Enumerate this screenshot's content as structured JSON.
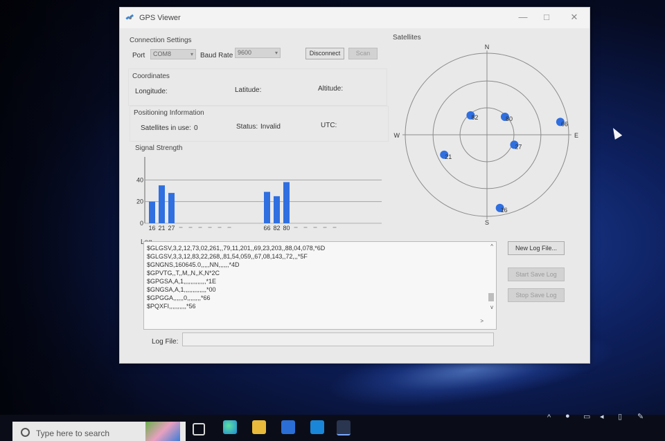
{
  "window": {
    "title": "GPS Viewer",
    "controls": {
      "minimize": "—",
      "maximize": "□",
      "close": "✕"
    }
  },
  "connection": {
    "heading": "Connection Settings",
    "port_label": "Port",
    "port_value": "COM8",
    "baud_label": "Baud Rate",
    "baud_value": "9600",
    "disconnect_label": "Disconnect",
    "scan_label": "Scan"
  },
  "coordinates": {
    "heading": "Coordinates",
    "longitude_label": "Longitude:",
    "latitude_label": "Latitude:",
    "altitude_label": "Altitude:"
  },
  "positioning": {
    "heading": "Positioning Information",
    "sats_label": "Satellites in use:",
    "sats_value": "0",
    "status_label": "Status:",
    "status_value": "Invalid",
    "utc_label": "UTC:"
  },
  "signal": {
    "heading": "Signal Strength"
  },
  "chart_data": {
    "type": "bar",
    "title": "Signal Strength",
    "y_ticks": [
      "0",
      "20",
      "40"
    ],
    "ylim": [
      0,
      60
    ],
    "bar_color": "#2f6fe0",
    "bars": [
      {
        "label": "16",
        "value": 20
      },
      {
        "label": "21",
        "value": 35
      },
      {
        "label": "27",
        "value": 28
      },
      {
        "label": "",
        "value": 0
      },
      {
        "label": "",
        "value": 0
      },
      {
        "label": "",
        "value": 0
      },
      {
        "label": "",
        "value": 0
      },
      {
        "label": "",
        "value": 0
      },
      {
        "label": "",
        "value": 0
      },
      {
        "label": "66",
        "value": 29
      },
      {
        "label": "82",
        "value": 25
      },
      {
        "label": "80",
        "value": 38
      },
      {
        "label": "",
        "value": 0
      },
      {
        "label": "",
        "value": 0
      },
      {
        "label": "",
        "value": 0
      },
      {
        "label": "",
        "value": 0
      },
      {
        "label": "",
        "value": 0
      }
    ]
  },
  "satellites": {
    "heading": "Satellites",
    "directions": {
      "n": "N",
      "e": "E",
      "s": "S",
      "w": "W"
    },
    "color": "#2f6fe0",
    "list": [
      {
        "id": "82",
        "azimuth": 320,
        "elevation": 62
      },
      {
        "id": "80",
        "azimuth": 45,
        "elevation": 62
      },
      {
        "id": "66",
        "azimuth": 80,
        "elevation": 8
      },
      {
        "id": "27",
        "azimuth": 110,
        "elevation": 58
      },
      {
        "id": "21",
        "azimuth": 245,
        "elevation": 38
      },
      {
        "id": "16",
        "azimuth": 170,
        "elevation": 8
      }
    ]
  },
  "log": {
    "heading": "Log",
    "lines": [
      "$GLGSV,3,2,12,73,02,261,,79,11,201,,69,23,203,,88,04,078,*6D",
      "$GLGSV,3,3,12,83,22,268,,81,54,059,,67,08,143,,72,,,*5F",
      "$GNGNS,160645.0,,,,,NN,,,,,,*4D",
      "$GPVTG,,T,,M,,N,,K,N*2C",
      "$GPGSA,A,1,,,,,,,,,,,,,*1E",
      "$GNGSA,A,1,,,,,,,,,,,,,*00",
      "$GPGGA,,,,,,0,,,,,,,,*66",
      "$PQXFI,,,,,,,,,,*56"
    ],
    "new_log_label": "New Log File...",
    "start_save_label": "Start Save Log",
    "stop_save_label": "Stop Save Log",
    "logfile_label": "Log File:",
    "logfile_value": ""
  },
  "taskbar": {
    "search_placeholder": "Type here to search"
  }
}
